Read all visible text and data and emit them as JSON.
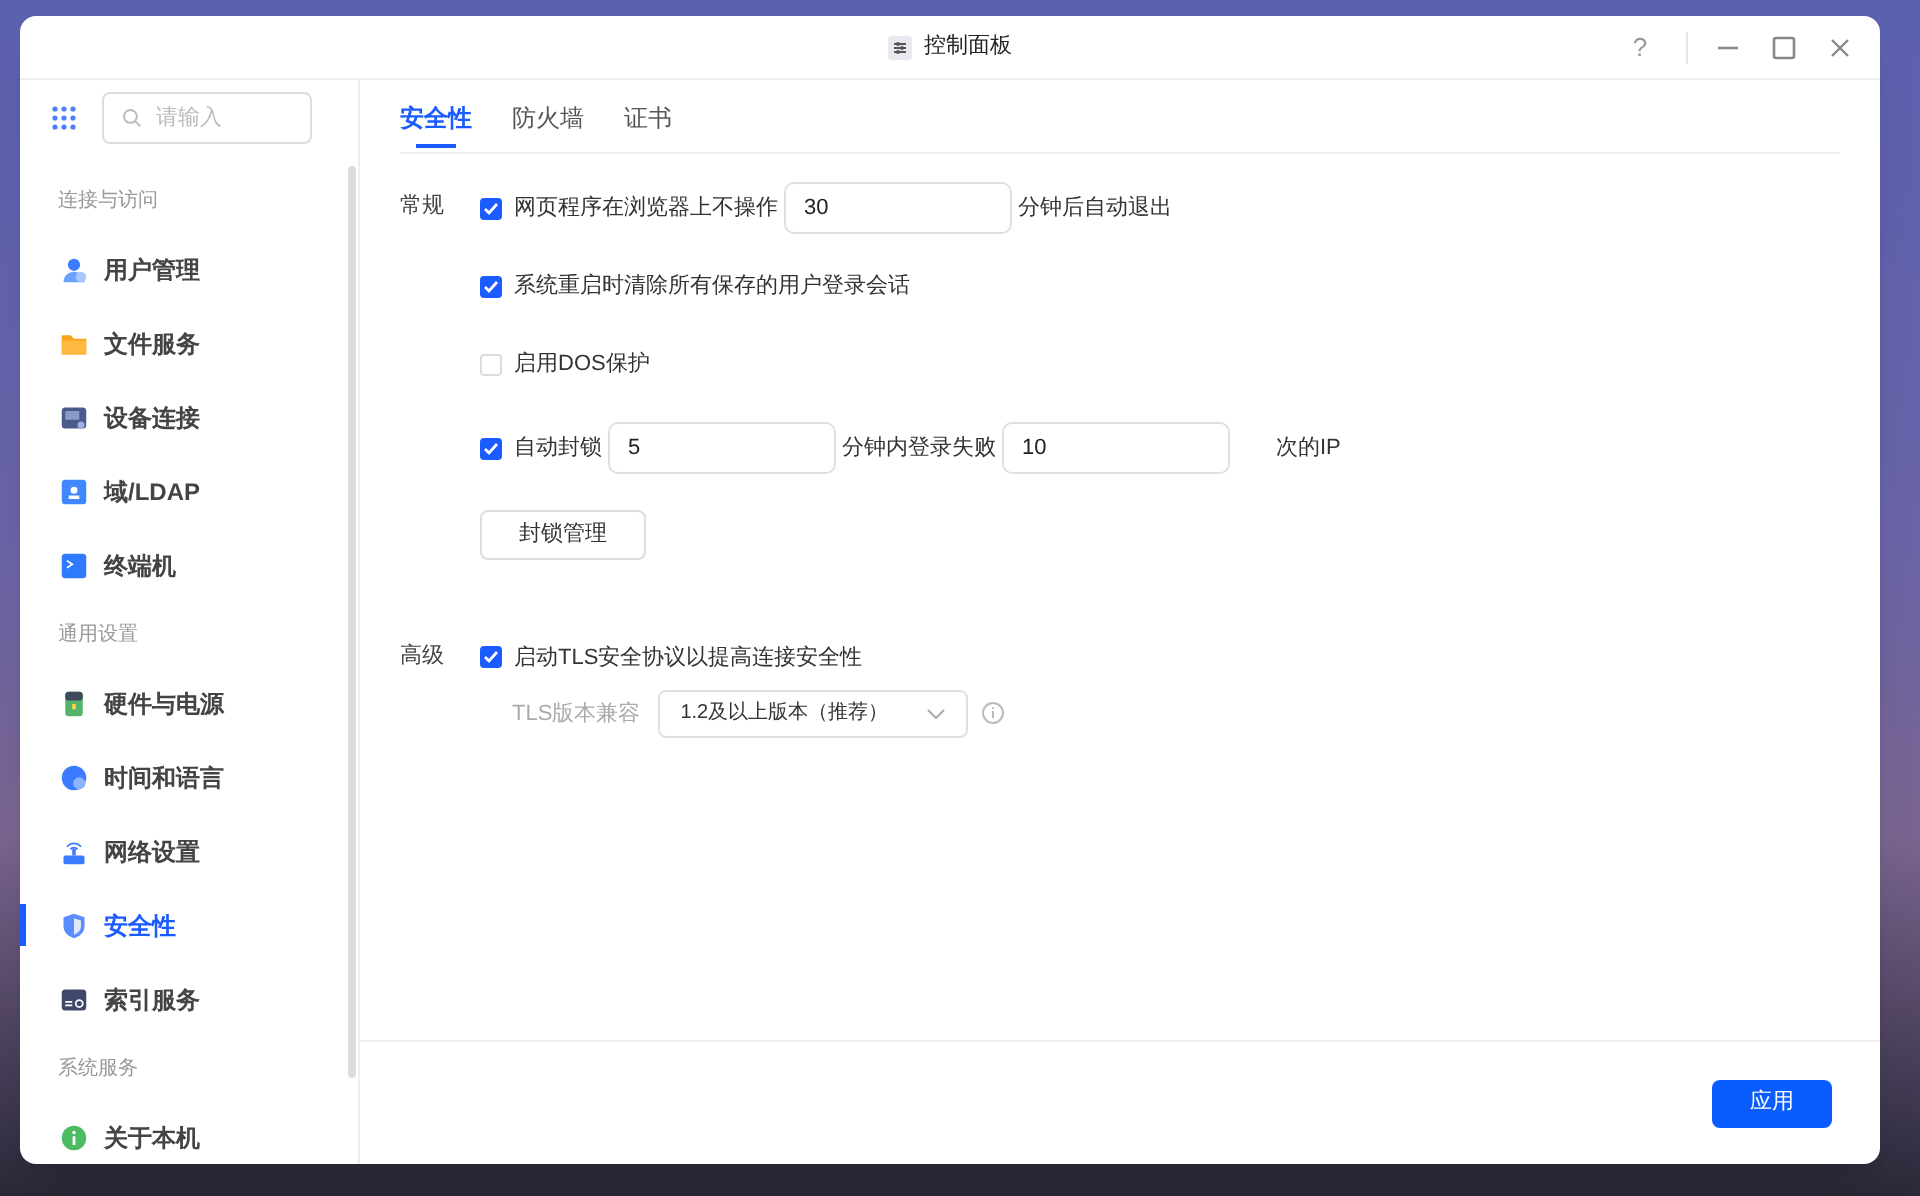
{
  "window": {
    "title": "控制面板",
    "help": "?"
  },
  "sidebar": {
    "search": {
      "placeholder": "请输入"
    },
    "groups": [
      {
        "heading": "连接与访问",
        "items": [
          {
            "label": "用户管理",
            "selected": false
          },
          {
            "label": "文件服务",
            "selected": false
          },
          {
            "label": "设备连接",
            "selected": false
          },
          {
            "label": "域/LDAP",
            "selected": false
          },
          {
            "label": "终端机",
            "selected": false
          }
        ]
      },
      {
        "heading": "通用设置",
        "items": [
          {
            "label": "硬件与电源",
            "selected": false
          },
          {
            "label": "时间和语言",
            "selected": false
          },
          {
            "label": "网络设置",
            "selected": false
          },
          {
            "label": "安全性",
            "selected": true
          },
          {
            "label": "索引服务",
            "selected": false
          }
        ]
      },
      {
        "heading": "系统服务",
        "items": [
          {
            "label": "关于本机",
            "selected": false
          }
        ]
      }
    ]
  },
  "tabs": [
    {
      "label": "安全性",
      "selected": true
    },
    {
      "label": "防火墙",
      "selected": false
    },
    {
      "label": "证书",
      "selected": false
    }
  ],
  "sections": [
    {
      "heading": "常规",
      "rows": [
        {
          "kind": "checkbox",
          "checked": true,
          "parts": [
            {
              "kind": "text",
              "text": "网页程序在浏览器上不操作"
            },
            {
              "kind": "field",
              "value": "30"
            },
            {
              "kind": "text",
              "text": "分钟后自动退出"
            }
          ]
        },
        {
          "kind": "checkbox",
          "checked": true,
          "parts": [
            {
              "kind": "text",
              "text": "系统重启时清除所有保存的用户登录会话"
            }
          ]
        },
        {
          "kind": "checkbox",
          "checked": false,
          "parts": [
            {
              "kind": "text",
              "text": "启用DOS保护"
            }
          ]
        },
        {
          "kind": "checkbox",
          "checked": true,
          "parts": [
            {
              "kind": "text",
              "text": "自动封锁"
            },
            {
              "kind": "field",
              "value": "5"
            },
            {
              "kind": "text",
              "text": "分钟内登录失败"
            },
            {
              "kind": "field",
              "value": "10"
            },
            {
              "kind": "text",
              "text": "次的IP"
            }
          ]
        },
        {
          "kind": "button",
          "label": "封锁管理"
        }
      ]
    },
    {
      "heading": "高级",
      "rows": [
        {
          "kind": "checkbox",
          "checked": true,
          "parts": [
            {
              "kind": "text",
              "text": "启动TLS安全协议以提高连接安全性"
            }
          ]
        },
        {
          "kind": "select",
          "label": "TLS版本兼容",
          "value": "1.2及以上版本（推荐）"
        }
      ]
    }
  ],
  "footer": {
    "apply": "应用"
  }
}
